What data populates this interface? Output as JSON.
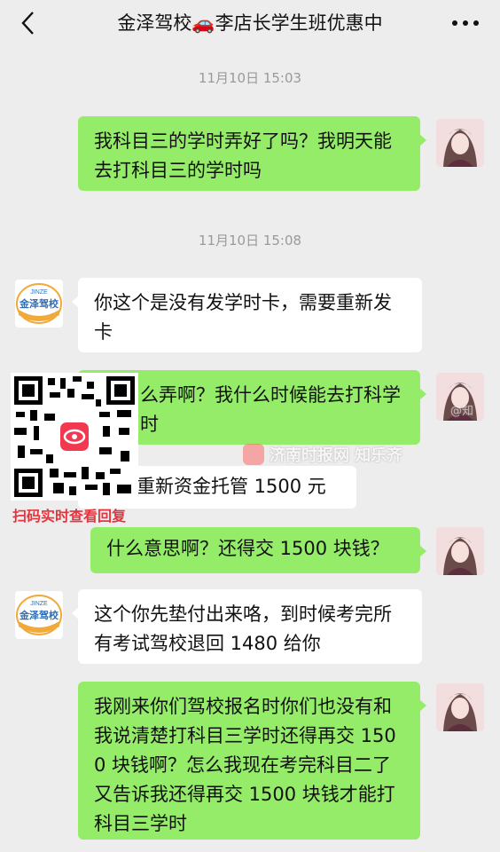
{
  "header": {
    "title": "金泽驾校🚗李店长学生班优惠中",
    "back_icon": "back-chevron-icon",
    "more_icon": "more-dots-icon"
  },
  "timestamps": [
    "11月10日 15:03",
    "11月10日 15:08"
  ],
  "messages": [
    {
      "from": "me",
      "text": "我科目三的学时弄好了吗？我明天能去打科目三的学时吗"
    },
    {
      "from": "them",
      "text": "你这个是没有发学时卡，需要重新发卡"
    },
    {
      "from": "me",
      "text": "么弄啊？我什么时候能去打科学时"
    },
    {
      "from": "them",
      "text": "重新资金托管 1500 元"
    },
    {
      "from": "me",
      "text": "什么意思啊？还得交 1500 块钱？"
    },
    {
      "from": "them",
      "text": "这个你先垫付出来咯，到时候考完所有考试驾校退回 1480 给你"
    },
    {
      "from": "me",
      "text": "我刚来你们驾校报名时你们也没有和我说清楚打科目三学时还得再交 1500 块钱啊？怎么我现在考完科目二了又告诉我还得再交 1500 块钱才能打科目三学时"
    }
  ],
  "school_logo": {
    "brand_small": "JINZE",
    "brand_name": "金泽驾校"
  },
  "overlay": {
    "qr_caption": "扫码实时查看回复",
    "watermark_text": "济南时报网  知乐齐",
    "watermark_small": "@知"
  },
  "colors": {
    "background": "#ededed",
    "my_bubble": "#95ec69",
    "their_bubble": "#ffffff",
    "caption_red": "#e8323c"
  }
}
